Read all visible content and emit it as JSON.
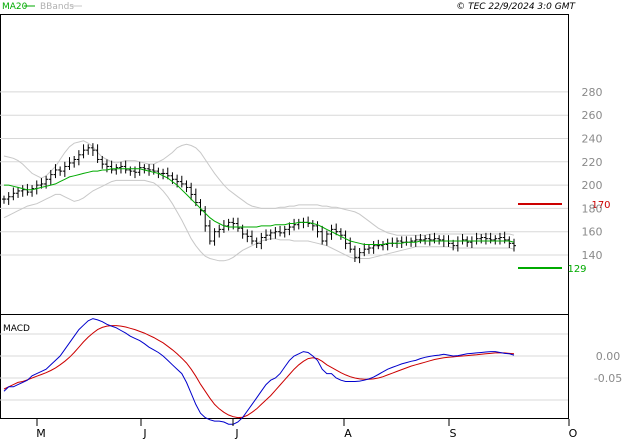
{
  "header": {
    "legend_ma": "MA20",
    "legend_bb": "BBands",
    "copyright": "© TEC 22/9/2024 3:0 GMT"
  },
  "colors": {
    "price": "#000000",
    "ma": "#00aa00",
    "bbands": "#c8c8c8",
    "macd": "#0000cc",
    "signal": "#cc0000",
    "resistance": "#cc0000",
    "support": "#00aa00",
    "grid": "#d8d8d8",
    "frame": "#000000"
  },
  "chart_data": [
    {
      "type": "ohlc",
      "name": "price",
      "yticks": [
        140,
        160,
        180,
        200,
        220,
        240,
        260,
        280
      ],
      "ylim": [
        130,
        290
      ],
      "x_months": [
        "M",
        "J",
        "J",
        "A",
        "S",
        "O"
      ],
      "month_positions": [
        0,
        23,
        44,
        66,
        88,
        110
      ],
      "closes": [
        188,
        190,
        193,
        195,
        196,
        194,
        197,
        200,
        201,
        205,
        209,
        213,
        212,
        216,
        219,
        222,
        226,
        230,
        232,
        230,
        222,
        218,
        216,
        213,
        215,
        216,
        213,
        212,
        211,
        215,
        214,
        213,
        212,
        210,
        210,
        208,
        205,
        203,
        201,
        198,
        192,
        185,
        178,
        165,
        152,
        160,
        162,
        165,
        168,
        167,
        163,
        158,
        156,
        152,
        150,
        155,
        157,
        159,
        160,
        159,
        162,
        164,
        166,
        168,
        168,
        167,
        165,
        160,
        152,
        158,
        162,
        160,
        157,
        150,
        145,
        138,
        142,
        145,
        146,
        148,
        148,
        149,
        150,
        150,
        152,
        151,
        151,
        152,
        153,
        153,
        154,
        153,
        154,
        153,
        152,
        150,
        148,
        152,
        153,
        151,
        152,
        154,
        155,
        154,
        153,
        154,
        155,
        153,
        150,
        148
      ],
      "ma20": [
        200,
        200,
        199,
        198,
        197,
        196,
        196,
        197,
        198,
        199,
        200,
        201,
        203,
        205,
        207,
        208,
        209,
        210,
        211,
        212,
        212,
        213,
        213,
        214,
        214,
        214,
        214,
        214,
        214,
        214,
        213,
        212,
        211,
        210,
        208,
        206,
        203,
        200,
        196,
        192,
        188,
        184,
        180,
        176,
        172,
        169,
        167,
        165,
        164,
        164,
        164,
        164,
        164,
        164,
        164,
        165,
        165,
        165,
        166,
        166,
        166,
        167,
        167,
        168,
        168,
        168,
        167,
        166,
        164,
        162,
        160,
        158,
        156,
        154,
        152,
        151,
        150,
        149,
        149,
        149,
        149,
        149,
        150,
        150,
        150,
        150,
        151,
        151,
        151,
        152,
        152,
        152,
        152,
        152,
        152,
        152,
        152,
        152,
        152,
        152,
        152,
        152,
        152,
        152,
        152,
        152,
        152,
        152,
        152,
        151
      ],
      "bb_upper": [
        225,
        224,
        223,
        221,
        218,
        214,
        210,
        208,
        206,
        208,
        212,
        216,
        222,
        228,
        233,
        236,
        237,
        238,
        236,
        233,
        228,
        224,
        222,
        220,
        219,
        220,
        221,
        221,
        221,
        220,
        219,
        218,
        218,
        220,
        222,
        225,
        228,
        232,
        234,
        235,
        234,
        232,
        228,
        222,
        216,
        210,
        205,
        200,
        196,
        193,
        190,
        187,
        184,
        182,
        181,
        180,
        180,
        180,
        180,
        181,
        181,
        182,
        182,
        183,
        183,
        183,
        183,
        183,
        182,
        182,
        181,
        181,
        180,
        179,
        178,
        177,
        175,
        172,
        169,
        166,
        163,
        161,
        159,
        158,
        157,
        157,
        157,
        157,
        157,
        157,
        157,
        158,
        158,
        158,
        158,
        158,
        158,
        158,
        158,
        158,
        158,
        158,
        158,
        158,
        158,
        158,
        158,
        158,
        158,
        157
      ],
      "bb_lower": [
        172,
        174,
        176,
        178,
        180,
        182,
        183,
        184,
        186,
        188,
        190,
        192,
        192,
        190,
        188,
        186,
        187,
        189,
        192,
        195,
        197,
        199,
        201,
        203,
        204,
        204,
        204,
        204,
        204,
        204,
        204,
        203,
        202,
        199,
        195,
        190,
        184,
        177,
        170,
        162,
        154,
        148,
        143,
        139,
        137,
        136,
        135,
        135,
        136,
        138,
        141,
        144,
        146,
        148,
        150,
        152,
        153,
        154,
        154,
        153,
        153,
        153,
        152,
        152,
        152,
        152,
        151,
        150,
        149,
        148,
        146,
        144,
        142,
        140,
        138,
        137,
        137,
        137,
        137,
        138,
        139,
        140,
        141,
        142,
        143,
        144,
        145,
        146,
        147,
        147,
        147,
        147,
        147,
        147,
        147,
        147,
        146,
        146,
        146,
        146,
        146,
        146,
        146,
        146,
        146,
        146,
        146,
        146,
        146,
        145
      ],
      "resistance": 170,
      "support": 129,
      "resistance_label": "170",
      "support_label": "129"
    },
    {
      "type": "macd",
      "name": "MACD",
      "label": "MACD",
      "yticks_labels": [
        "0.00",
        "-0.05"
      ],
      "yticks": [
        0.0,
        -0.05
      ],
      "ylim": [
        -0.17,
        0.11
      ],
      "macd": [
        -0.08,
        -0.07,
        -0.07,
        -0.065,
        -0.06,
        -0.055,
        -0.045,
        -0.04,
        -0.035,
        -0.03,
        -0.02,
        -0.01,
        0.0,
        0.015,
        0.03,
        0.045,
        0.06,
        0.07,
        0.08,
        0.085,
        0.082,
        0.078,
        0.072,
        0.068,
        0.064,
        0.058,
        0.052,
        0.045,
        0.04,
        0.035,
        0.028,
        0.02,
        0.014,
        0.008,
        0.0,
        -0.01,
        -0.02,
        -0.03,
        -0.04,
        -0.06,
        -0.085,
        -0.11,
        -0.13,
        -0.14,
        -0.145,
        -0.148,
        -0.148,
        -0.15,
        -0.155,
        -0.155,
        -0.15,
        -0.14,
        -0.125,
        -0.11,
        -0.095,
        -0.08,
        -0.065,
        -0.055,
        -0.05,
        -0.04,
        -0.025,
        -0.01,
        0.0,
        0.005,
        0.01,
        0.008,
        0.0,
        -0.01,
        -0.03,
        -0.04,
        -0.04,
        -0.05,
        -0.055,
        -0.058,
        -0.058,
        -0.058,
        -0.057,
        -0.055,
        -0.052,
        -0.048,
        -0.042,
        -0.036,
        -0.03,
        -0.026,
        -0.022,
        -0.018,
        -0.015,
        -0.012,
        -0.01,
        -0.006,
        -0.003,
        -0.001,
        0.001,
        0.002,
        0.004,
        0.002,
        0.0,
        0.001,
        0.003,
        0.005,
        0.006,
        0.007,
        0.008,
        0.009,
        0.01,
        0.01,
        0.008,
        0.006,
        0.005,
        0.002
      ],
      "signal": [
        -0.075,
        -0.07,
        -0.065,
        -0.06,
        -0.058,
        -0.054,
        -0.05,
        -0.046,
        -0.042,
        -0.038,
        -0.033,
        -0.027,
        -0.02,
        -0.012,
        -0.003,
        0.008,
        0.02,
        0.032,
        0.043,
        0.052,
        0.06,
        0.065,
        0.068,
        0.069,
        0.069,
        0.068,
        0.066,
        0.063,
        0.06,
        0.056,
        0.052,
        0.047,
        0.042,
        0.036,
        0.03,
        0.022,
        0.014,
        0.005,
        -0.005,
        -0.016,
        -0.03,
        -0.046,
        -0.064,
        -0.08,
        -0.096,
        -0.11,
        -0.12,
        -0.128,
        -0.134,
        -0.138,
        -0.14,
        -0.139,
        -0.135,
        -0.128,
        -0.12,
        -0.11,
        -0.1,
        -0.09,
        -0.078,
        -0.066,
        -0.054,
        -0.042,
        -0.03,
        -0.02,
        -0.012,
        -0.006,
        -0.004,
        -0.006,
        -0.012,
        -0.02,
        -0.026,
        -0.032,
        -0.038,
        -0.043,
        -0.047,
        -0.05,
        -0.052,
        -0.053,
        -0.053,
        -0.052,
        -0.05,
        -0.047,
        -0.043,
        -0.039,
        -0.035,
        -0.031,
        -0.027,
        -0.023,
        -0.02,
        -0.017,
        -0.014,
        -0.011,
        -0.008,
        -0.006,
        -0.004,
        -0.003,
        -0.002,
        -0.001,
        0.0,
        0.001,
        0.002,
        0.003,
        0.004,
        0.005,
        0.006,
        0.007,
        0.007,
        0.007,
        0.006,
        0.005
      ]
    }
  ]
}
